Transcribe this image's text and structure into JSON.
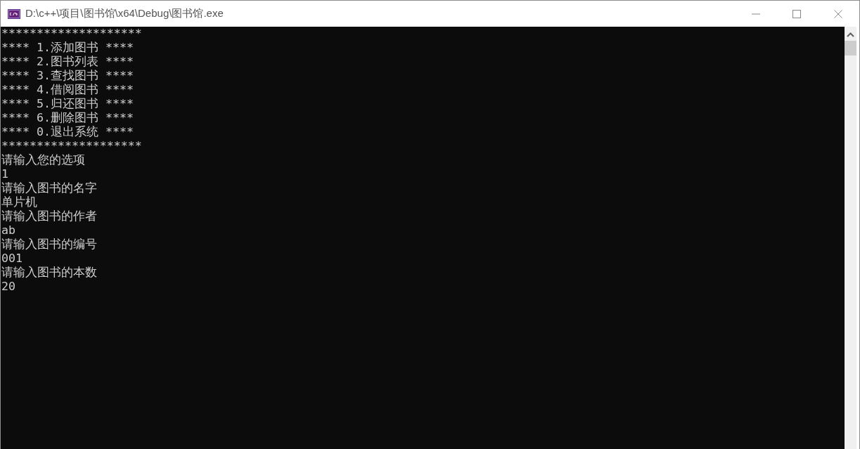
{
  "window": {
    "title": "D:\\c++\\项目\\图书馆\\x64\\Debug\\图书馆.exe"
  },
  "console": {
    "lines": [
      "********************",
      "**** 1.添加图书 ****",
      "**** 2.图书列表 ****",
      "**** 3.查找图书 ****",
      "**** 4.借阅图书 ****",
      "**** 5.归还图书 ****",
      "**** 6.删除图书 ****",
      "**** 0.退出系统 ****",
      "********************",
      "请输入您的选项",
      "1",
      "请输入图书的名字",
      "单片机",
      "请输入图书的作者",
      "ab",
      "请输入图书的编号",
      "001",
      "请输入图书的本数",
      "20"
    ]
  }
}
